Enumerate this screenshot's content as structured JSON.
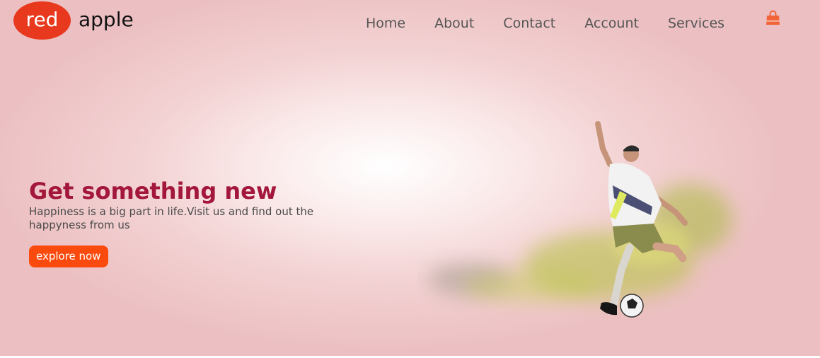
{
  "brand": {
    "badge_text": "red",
    "wordmark": "apple",
    "badge_color": "#e8391e"
  },
  "nav": {
    "items": [
      {
        "label": "Home"
      },
      {
        "label": "About"
      },
      {
        "label": "Contact"
      },
      {
        "label": "Account"
      },
      {
        "label": "Services"
      }
    ],
    "cart_icon": "shopping-bag-icon"
  },
  "hero": {
    "headline": "Get something new",
    "subtext": "Happiness is a big part in life.Visit us and find out the happyness from us",
    "cta_label": "explore now",
    "image": "soccer-player-kicking-ball-illustration"
  },
  "colors": {
    "headline": "#a3173c",
    "cta": "#fb4a0d",
    "accent_cart": "#f0643a",
    "background": "#ecc0c2"
  }
}
